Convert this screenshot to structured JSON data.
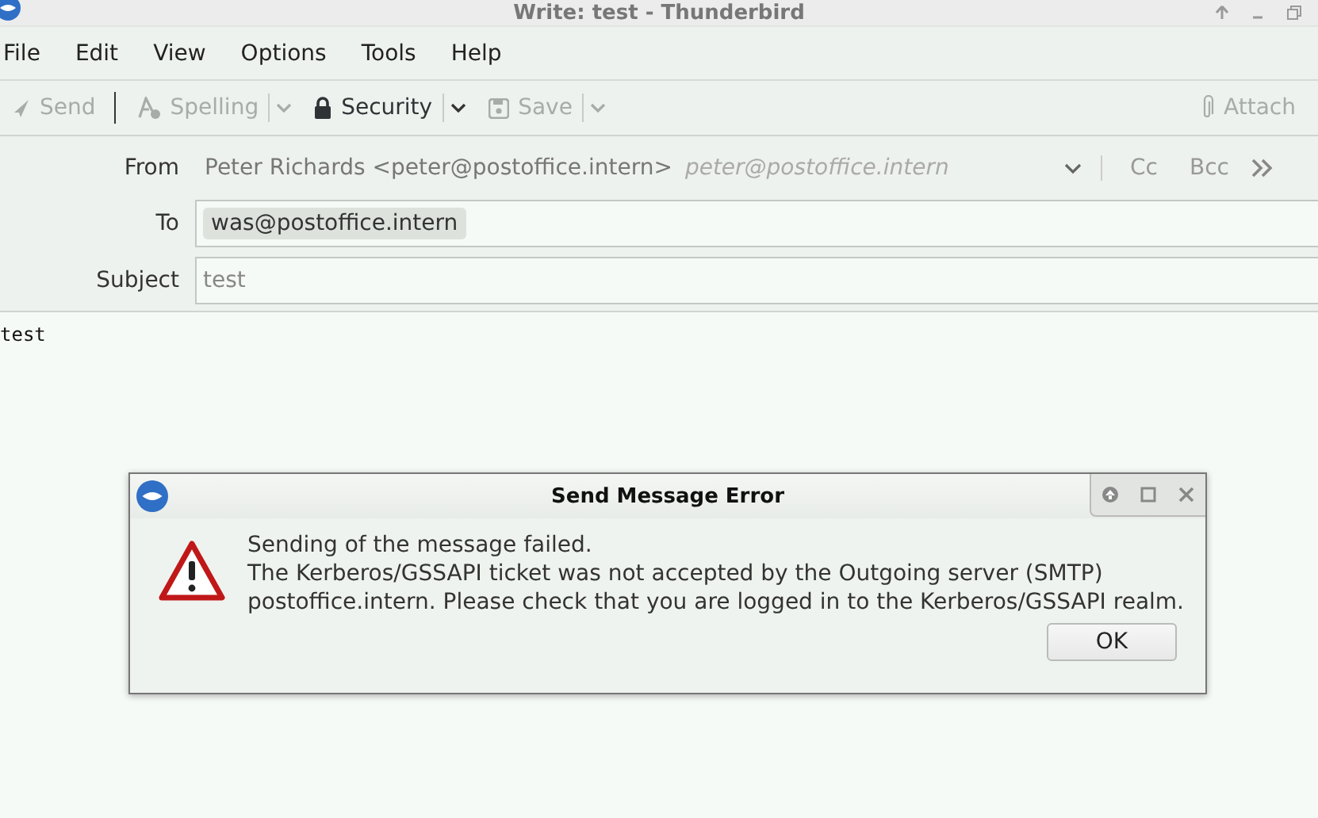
{
  "window": {
    "title": "Write: test - Thunderbird"
  },
  "menu": [
    "File",
    "Edit",
    "View",
    "Options",
    "Tools",
    "Help"
  ],
  "toolbar": [
    {
      "kind": "send",
      "label": "Send",
      "disabled": true,
      "dropdown": false
    },
    {
      "kind": "spelling",
      "label": "Spelling",
      "disabled": true,
      "dropdown": true
    },
    {
      "kind": "security",
      "label": "Security",
      "disabled": false,
      "dropdown": true
    },
    {
      "kind": "save",
      "label": "Save",
      "disabled": true,
      "dropdown": true
    },
    {
      "kind": "attach",
      "label": "Attach",
      "disabled": true,
      "dropdown": false
    }
  ],
  "from": {
    "label": "From",
    "identity": "Peter Richards <peter@postoffice.intern>",
    "address": "peter@postoffice.intern",
    "cc": "Cc",
    "bcc": "Bcc"
  },
  "to": {
    "label": "To",
    "recipients": [
      "was@postoffice.intern"
    ]
  },
  "subject": {
    "label": "Subject",
    "value": "test"
  },
  "body": "test",
  "dialog": {
    "title": "Send Message Error",
    "lines": [
      "Sending of the message failed.",
      "The Kerberos/GSSAPI ticket was not accepted by the Outgoing server (SMTP)",
      "postoffice.intern. Please check that you are logged in to the Kerberos/GSSAPI realm."
    ],
    "button": "OK"
  }
}
